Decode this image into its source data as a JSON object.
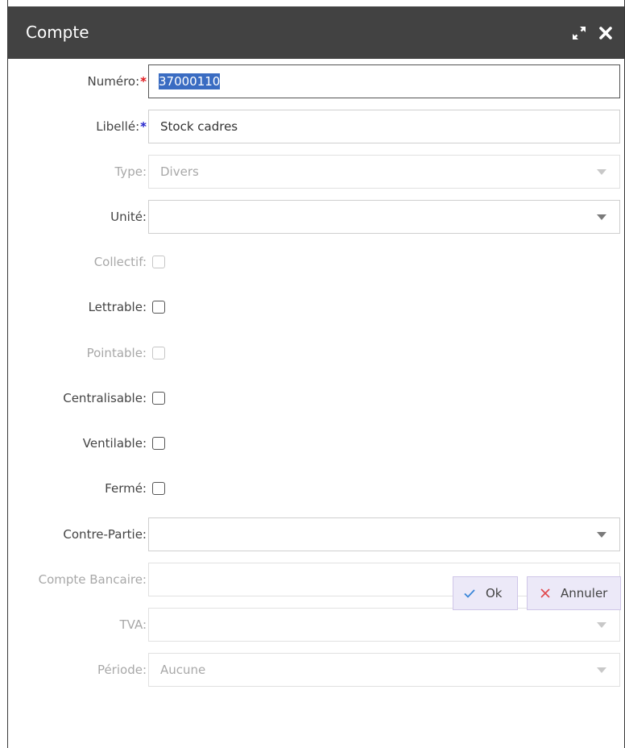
{
  "dialog": {
    "title": "Compte"
  },
  "fields": {
    "numero": {
      "label": "Numéro:",
      "required_mark": "*",
      "value": "37000110"
    },
    "libelle": {
      "label": "Libellé:",
      "required_mark": "*",
      "value": "Stock cadres"
    },
    "type": {
      "label": "Type:",
      "value": "Divers"
    },
    "unite": {
      "label": "Unité:",
      "value": ""
    },
    "collectif": {
      "label": "Collectif:"
    },
    "lettrable": {
      "label": "Lettrable:"
    },
    "pointable": {
      "label": "Pointable:"
    },
    "centralisable": {
      "label": "Centralisable:"
    },
    "ventilable": {
      "label": "Ventilable:"
    },
    "ferme": {
      "label": "Fermé:"
    },
    "contre_partie": {
      "label": "Contre-Partie:",
      "value": ""
    },
    "compte_bancaire": {
      "label": "Compte Bancaire:",
      "value": ""
    },
    "tva": {
      "label": "TVA:",
      "value": ""
    },
    "periode": {
      "label": "Période:",
      "value": "Aucune"
    }
  },
  "buttons": {
    "ok": "Ok",
    "cancel": "Annuler"
  },
  "icons": {
    "expand": "expand-icon",
    "close": "close-icon",
    "check": "check-icon",
    "cross": "cross-icon"
  },
  "colors": {
    "titlebar": "#424242",
    "required_red": "#e0151b",
    "required_blue": "#2222cc",
    "selection": "#3a6cc2",
    "button_bg": "#ece9f8"
  }
}
